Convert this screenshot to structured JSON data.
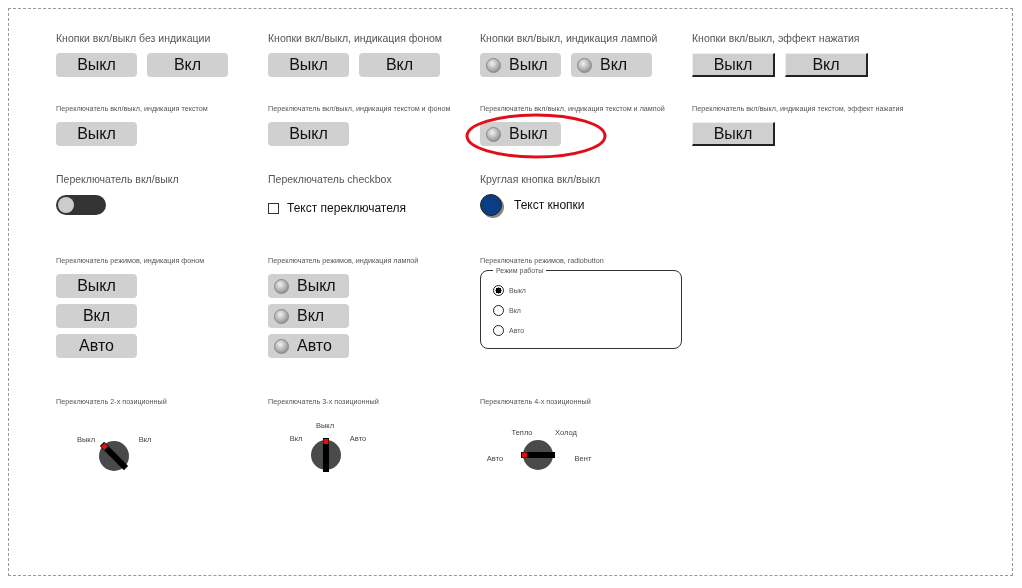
{
  "rows": [
    [
      {
        "kind": "plain_buttons",
        "title": "Кнопки вкл/выкл без индикации",
        "buttons": [
          {
            "text": "Выкл"
          },
          {
            "text": "Вкл"
          }
        ]
      },
      {
        "kind": "bg_buttons",
        "title": "Кнопки вкл/выкл, индикация фоном",
        "buttons": [
          {
            "text": "Выкл",
            "on": false
          },
          {
            "text": "Вкл",
            "on": false
          }
        ]
      },
      {
        "kind": "lamp_buttons",
        "title": "Кнопки вкл/выкл, индикация лампой",
        "buttons": [
          {
            "text": "Выкл",
            "on": false
          },
          {
            "text": "Вкл",
            "on": false
          }
        ]
      },
      {
        "kind": "raised_buttons",
        "title": "Кнопки вкл/выкл, эффект нажатия",
        "buttons": [
          {
            "text": "Выкл",
            "pressed": false
          },
          {
            "text": "Вкл",
            "pressed": false
          }
        ]
      }
    ],
    [
      {
        "kind": "plain_buttons",
        "title": "Переключатель вкл/выкл, индикация текстом",
        "buttons": [
          {
            "text": "Выкл"
          }
        ]
      },
      {
        "kind": "bg_buttons",
        "title": "Переключатель вкл/выкл, индикация текстом и фоном",
        "buttons": [
          {
            "text": "Выкл",
            "on": false
          }
        ]
      },
      {
        "kind": "lamp_buttons",
        "title": "Переключатель вкл/выкл, индикация текстом и лампой",
        "highlighted": true,
        "buttons": [
          {
            "text": "Выкл",
            "on": false
          }
        ]
      },
      {
        "kind": "raised_buttons",
        "title": "Переключатель вкл/выкл, индикация текстом, эффект нажатия",
        "buttons": [
          {
            "text": "Выкл",
            "pressed": false
          }
        ]
      }
    ],
    [
      {
        "kind": "toggle",
        "title": "Переключатель вкл/выкл",
        "on": false
      },
      {
        "kind": "checkbox",
        "title": "Переключатель checkbox",
        "text": "Текст переключателя",
        "checked": false
      },
      {
        "kind": "round_button",
        "title": "Круглая кнопка вкл/выкл",
        "text": "Текст кнопки",
        "on": true
      }
    ],
    [
      {
        "kind": "mode_buttons",
        "title": "Переключатель режимов, индикация фоном",
        "buttons": [
          {
            "text": "Выкл",
            "selected": false
          },
          {
            "text": "Вкл",
            "selected": false
          },
          {
            "text": "Авто",
            "selected": false
          }
        ]
      },
      {
        "kind": "mode_lamps",
        "title": "Переключатель режимов, индикация лампой",
        "buttons": [
          {
            "text": "Выкл",
            "selected": false
          },
          {
            "text": "Вкл",
            "selected": false
          },
          {
            "text": "Авто",
            "selected": false
          }
        ]
      },
      {
        "kind": "radio_group",
        "title": "Переключатель режимов, radiobutton",
        "legend": "Режим работы",
        "options": [
          {
            "text": "Выкл",
            "selected": true
          },
          {
            "text": "Вкл",
            "selected": false
          },
          {
            "text": "Авто",
            "selected": false
          }
        ]
      }
    ],
    [
      {
        "kind": "knob",
        "title": "Переключатель 2-х позиционный",
        "positions": [
          {
            "text": "Выкл",
            "selected": true
          },
          {
            "text": "Вкл",
            "selected": false
          }
        ]
      },
      {
        "kind": "knob",
        "title": "Переключатель 3-х позиционный",
        "positions": [
          {
            "text": "Вкл",
            "selected": false
          },
          {
            "text": "Выкл",
            "selected": true
          },
          {
            "text": "Авто",
            "selected": false
          }
        ]
      },
      {
        "kind": "knob",
        "title": "Переключатель 4-х позиционный",
        "positions": [
          {
            "text": "Тепло",
            "selected": false
          },
          {
            "text": "Холод",
            "selected": false
          },
          {
            "text": "Авто",
            "selected": true
          },
          {
            "text": "Вент",
            "selected": false
          }
        ]
      }
    ]
  ]
}
